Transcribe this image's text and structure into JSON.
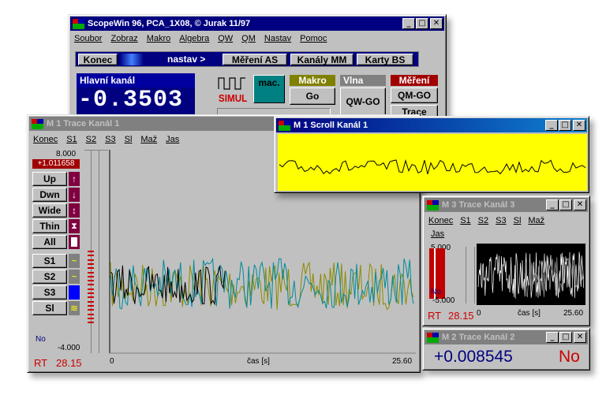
{
  "main_window": {
    "title": "ScopeWin 96, PCA_1X08,  © Jurak 11/97",
    "menu": [
      "Soubor",
      "Zobraz",
      "Makro",
      "Algebra",
      "QW",
      "QM",
      "Nastav",
      "Pomoc"
    ],
    "toolbar": {
      "konec": "Konec",
      "nastav": "nastav >",
      "mereni_as": "Měření AS",
      "kanaly_mm": "Kanály MM",
      "karty_bs": "Karty BS"
    },
    "main_channel_label": "Hlavní kanál",
    "main_channel_value": "-0.3503",
    "simul_label": "SIMUL",
    "mac_label": "mac.",
    "makro": {
      "header": "Makro",
      "go": "Go"
    },
    "vlna": {
      "header": "Vlna",
      "qwgo": "QW-GO"
    },
    "mereni": {
      "header": "Měření",
      "qmgo": "QM-GO",
      "trace": "Trace"
    }
  },
  "trace1": {
    "title": "M 1 Trace  Kanál 1",
    "menu": [
      "Konec",
      "S1",
      "S2",
      "S3",
      "Sl",
      "Maž",
      "Jas"
    ],
    "y_max": "8.000",
    "cursor_value": "+1.011658",
    "buttons": {
      "up": "Up",
      "dwn": "Dwn",
      "wide": "Wide",
      "thin": "Thin",
      "all": "All",
      "s1": "S1",
      "s2": "S2",
      "s3": "S3",
      "sl": "Sl"
    },
    "no_label": "No",
    "y_min": "-4.000",
    "rt_label": "RT",
    "rt_value": "28.15",
    "x_start": "0",
    "x_label": "čas [s]",
    "x_end": "25.60"
  },
  "scroll1": {
    "title": "M 1 Scroll Kanál 1"
  },
  "trace3": {
    "title": "M 3 Trace  Kanál 3",
    "menu": [
      "Konec",
      "S1",
      "S2",
      "S3",
      "Sl",
      "Maž"
    ],
    "menu2": "Jas",
    "y_max": "5.000",
    "no_label": "No",
    "y_min": "-5.000",
    "x_start": "0",
    "x_label": "čas [s]",
    "x_end": "25.60",
    "rt_label": "RT",
    "rt_value": "28.15"
  },
  "trace2": {
    "title": "M 2 Trace  Kanál 2",
    "value": "+0.008545",
    "status": "No"
  },
  "colors": {
    "title_active": "#000080",
    "title_inactive": "#808080",
    "yellow_bg": "#ffff00",
    "teal": "#008080",
    "series_black": "#000000",
    "series_teal": "#008b9a",
    "series_olive": "#8b8b00",
    "red_text": "#cc0000",
    "blue_text": "#000080"
  }
}
